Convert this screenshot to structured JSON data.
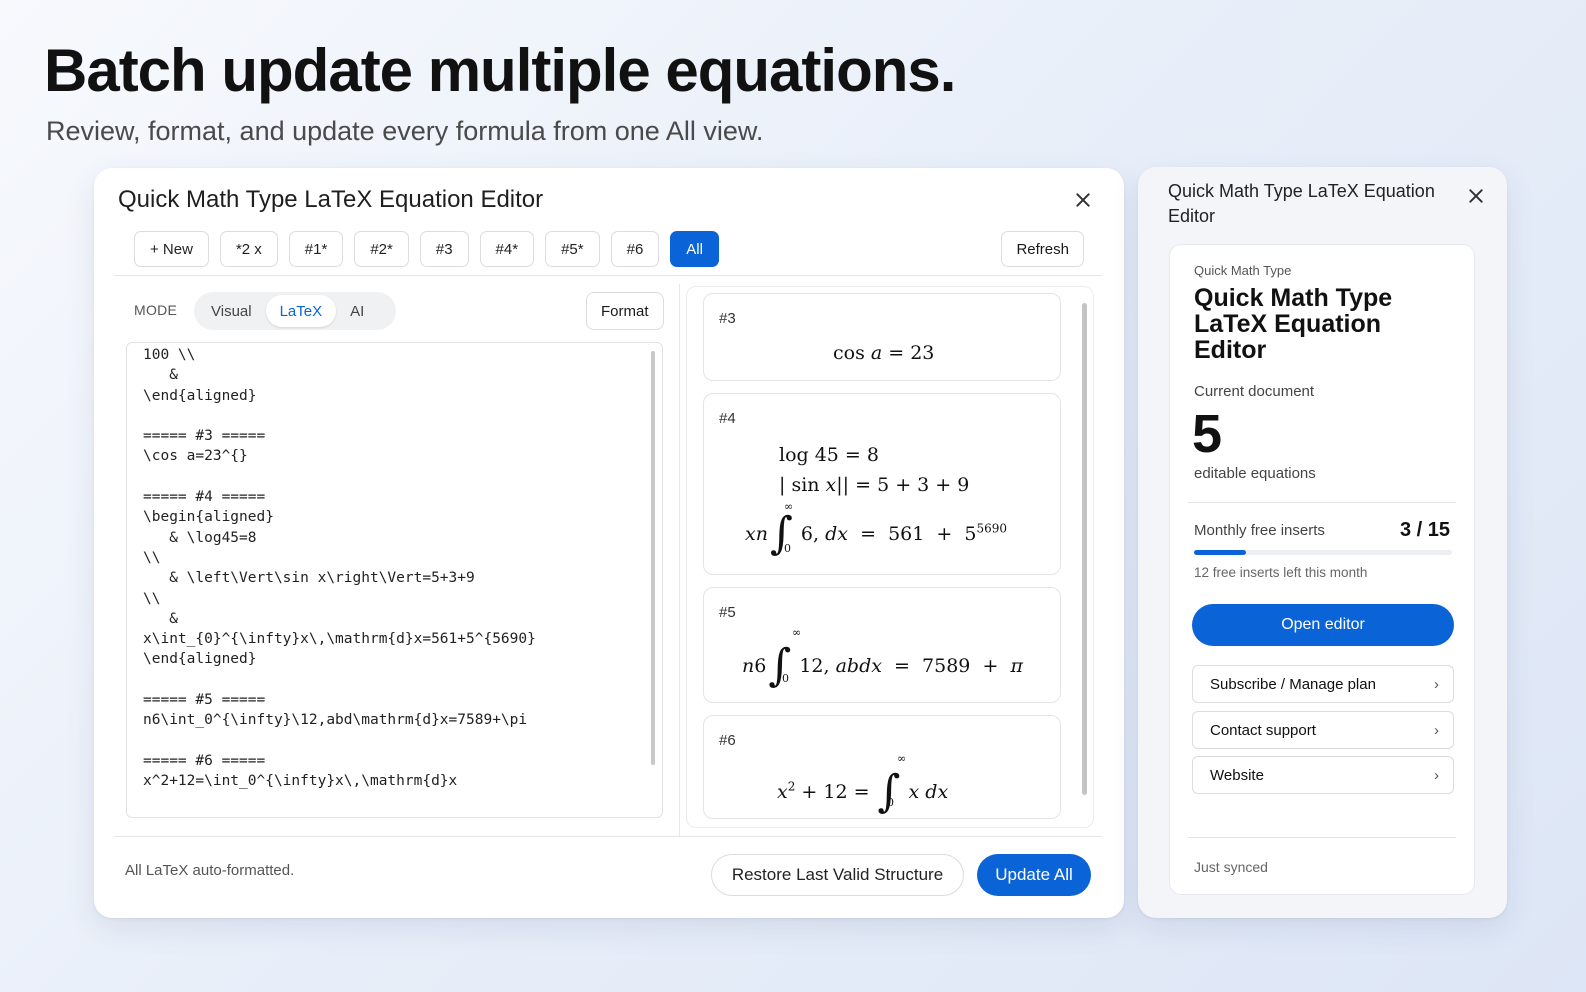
{
  "hero": {
    "title": "Batch update multiple equations.",
    "subtitle": "Review, format, and update every formula from one All view."
  },
  "editor": {
    "title": "Quick Math Type LaTeX Equation Editor",
    "tabs": [
      "+ New",
      "*2 x",
      "#1*",
      "#2*",
      "#3",
      "#4*",
      "#5*",
      "#6",
      "All"
    ],
    "active_tab": "All",
    "refresh_label": "Refresh",
    "mode_label": "MODE",
    "modes": [
      "Visual",
      "LaTeX",
      "AI"
    ],
    "active_mode": "LaTeX",
    "format_label": "Format",
    "latex_source": "100 \\\\\n   &\n\\end{aligned}\n\n===== #3 =====\n\\cos a=23^{}\n\n===== #4 =====\n\\begin{aligned}\n   & \\log45=8\n\\\\\n   & \\left\\Vert\\sin x\\right\\Vert=5+3+9\n\\\\\n   &\nx\\int_{0}^{\\infty}x\\,\\mathrm{d}x=561+5^{5690}\n\\end{aligned}\n\n===== #5 =====\nn6\\int_0^{\\infty}\\12,abd\\mathrm{d}x=7589+\\pi\n\n===== #6 =====\nx^2+12=\\int_0^{\\infty}x\\,\\mathrm{d}x",
    "preview": {
      "eq3": {
        "id": "#3"
      },
      "eq4": {
        "id": "#4"
      },
      "eq5": {
        "id": "#5"
      },
      "eq6": {
        "id": "#6"
      }
    },
    "status": "All LaTeX auto-formatted.",
    "restore_label": "Restore Last Valid Structure",
    "update_label": "Update All",
    "accent": "#0b63d8"
  },
  "side": {
    "title": "Quick Math Type LaTeX Equation Editor",
    "kicker": "Quick Math Type",
    "card_title": "Quick Math Type LaTeX Equation Editor",
    "current_doc_label": "Current document",
    "equation_count": "5",
    "equation_count_label": "editable equations",
    "monthly_label": "Monthly free inserts",
    "monthly_count": "3 / 15",
    "monthly_used_fraction": 0.2,
    "left_text": "12 free inserts left this month",
    "open_label": "Open editor",
    "links": [
      "Subscribe / Manage plan",
      "Contact support",
      "Website"
    ],
    "sync_text": "Just synced"
  }
}
